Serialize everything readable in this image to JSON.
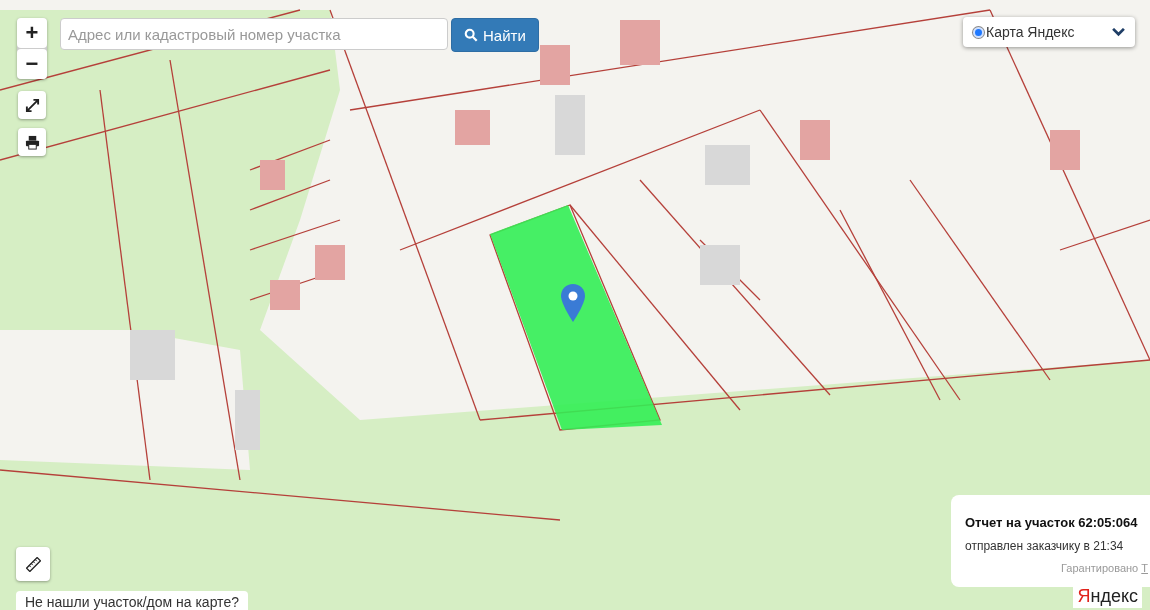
{
  "map_controls": {
    "zoom_in": "+",
    "zoom_out": "−"
  },
  "search": {
    "placeholder": "Адрес или кадастровый номер участка",
    "button": "Найти"
  },
  "map_type": {
    "label": "Карта Яндекс",
    "selected": true
  },
  "notice": {
    "title": "Отчет на участок 62:05:064",
    "text": "отправлен заказчику в 21:34",
    "footer": "Гарантировано",
    "footer_link": "Т"
  },
  "help_button": "Не нашли участок/дом на карте?",
  "map_logo": "Яндекс"
}
